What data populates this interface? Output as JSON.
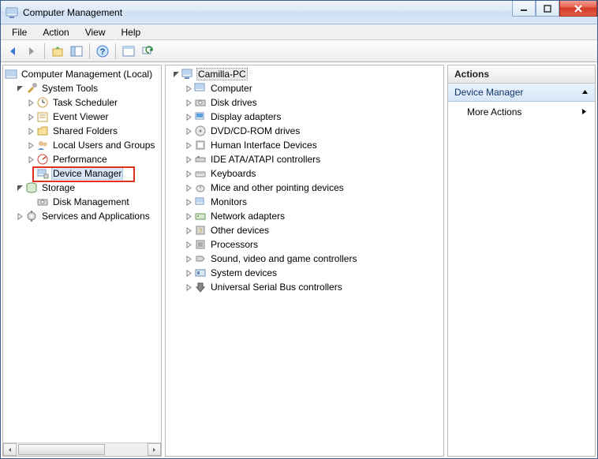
{
  "window": {
    "title": "Computer Management"
  },
  "menu": {
    "file": "File",
    "action": "Action",
    "view": "View",
    "help": "Help"
  },
  "left_tree": {
    "root": "Computer Management (Local)",
    "system_tools": "System Tools",
    "task_scheduler": "Task Scheduler",
    "event_viewer": "Event Viewer",
    "shared_folders": "Shared Folders",
    "local_users": "Local Users and Groups",
    "performance": "Performance",
    "device_manager": "Device Manager",
    "storage": "Storage",
    "disk_management": "Disk Management",
    "services_apps": "Services and Applications"
  },
  "center_tree": {
    "root": "Camilla-PC",
    "items": [
      "Computer",
      "Disk drives",
      "Display adapters",
      "DVD/CD-ROM drives",
      "Human Interface Devices",
      "IDE ATA/ATAPI controllers",
      "Keyboards",
      "Mice and other pointing devices",
      "Monitors",
      "Network adapters",
      "Other devices",
      "Processors",
      "Sound, video and game controllers",
      "System devices",
      "Universal Serial Bus controllers"
    ]
  },
  "actions": {
    "header": "Actions",
    "section": "Device Manager",
    "more": "More Actions"
  }
}
